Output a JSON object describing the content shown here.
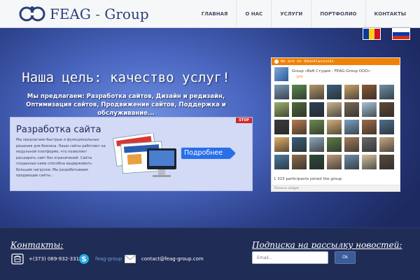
{
  "header": {
    "logo_main": "FEAG",
    "logo_dash": " - ",
    "logo_group": "Group",
    "nav": [
      "ГЛАВНАЯ",
      "О НАС",
      "УСЛУГИ",
      "ПОРТФОЛИО",
      "КОНТАКТЫ"
    ]
  },
  "hero": {
    "title": "Наша цель: качество услуг!",
    "subtitle": "Мы предлагаем: Разработка сайтов, Дизайн и редизайн, Оптимизация сайтов, Продвижение сайтов, Поддержка и обслуживание..."
  },
  "slide": {
    "badge": "STOP",
    "title": "Разработка сайта",
    "text": "Мы предлагаем быстрые и функциональные решения для бизнеса. Наши сайты работают на модульной платформе, что позволяет расширять сайт без ограничений. Сайты созданные нами способны выдерживать большие нагрузки. Мы разрабатываем продающие сайты...",
    "button": "Подробнее"
  },
  "widget": {
    "header": "We are on Odnoklassniki",
    "group_name": "Group «Веб Студия - FEAG-Group ООО»",
    "join": "Join",
    "participants": "1 315 participants joined the group",
    "footer": "Remove widget",
    "tile_colors": [
      "#7b9bb8",
      "#5a8a4f",
      "#b3976b",
      "#3d5f7a",
      "#c9a36a",
      "#8a5a3a",
      "#6d8fa9",
      "#9bb06a",
      "#4f6a3c",
      "#2e4154",
      "#c7b38e",
      "#7a6a58",
      "#a6c1d6",
      "#5e4a3a",
      "#3a3a3a",
      "#b57a4e",
      "#6b8b4f",
      "#d0b07a",
      "#7aa0c0",
      "#9c6b4a",
      "#4c6e8e",
      "#e0b06a",
      "#3b5f7a",
      "#8fa6b8",
      "#5f7d4a",
      "#a07e5a",
      "#6a6a6a",
      "#c6a886",
      "#4d7aa0",
      "#8b6d4c",
      "#2f4a3a",
      "#b89a7a",
      "#6e8ea8",
      "#d2c0a0",
      "#5a4c40"
    ]
  },
  "footer": {
    "contacts_title": "Контакты:",
    "phone": "+(373) 069-932-331",
    "skype": "feag-group",
    "email": "contact@feag-group.com",
    "subscribe_title": "Подписка на рассылку новостей:",
    "email_placeholder": "Email...",
    "ok_button": "Ok"
  },
  "colors": {
    "accent_orange": "#ee8208",
    "header_bg": "#f6f7f9",
    "footer_bg": "#1f2c55",
    "button_blue": "#2a6ee8"
  }
}
